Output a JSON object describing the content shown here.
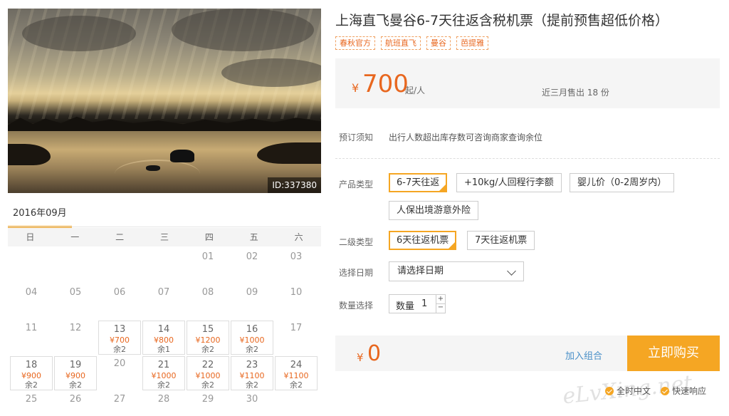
{
  "hero": {
    "id_label": "ID:337380"
  },
  "calendar": {
    "month": "2016年09月",
    "weekdays": [
      "日",
      "一",
      "二",
      "三",
      "四",
      "五",
      "六"
    ]
  },
  "product": {
    "title": "上海直飞曼谷6-7天往返含税机票（提前预售超低价格）",
    "tags": [
      "春秋官方",
      "航班直飞",
      "曼谷",
      "芭提雅"
    ],
    "price": {
      "currency": "¥",
      "value": "700",
      "unit": "起/人",
      "sold": "近三月售出 18 份"
    },
    "notice": {
      "label": "预订须知",
      "text": "出行人数超出库存数可咨询商家查询余位"
    },
    "product_type": {
      "label": "产品类型",
      "options": [
        "6-7天往返",
        "+10kg/人回程行李额",
        "婴儿价（0-2周岁内）",
        "人保出境游意外险"
      ]
    },
    "sub_type": {
      "label": "二级类型",
      "options": [
        "6天往返机票",
        "7天往返机票"
      ]
    },
    "date": {
      "label": "选择日期",
      "placeholder": "请选择日期"
    },
    "quantity": {
      "label": "数量选择",
      "field_label": "数量",
      "value": "1",
      "plus": "+",
      "minus": "−"
    },
    "total": {
      "currency": "¥",
      "value": "0"
    },
    "combo_label": "加入组合",
    "buy_label": "立即购买",
    "features": [
      "全时中文",
      "快速响应"
    ],
    "watermark": "eLvXing.net"
  },
  "days": [
    {
      "d": "01"
    },
    {
      "d": "02"
    },
    {
      "d": "03"
    },
    {
      "d": "04"
    },
    {
      "d": "05"
    },
    {
      "d": "06"
    },
    {
      "d": "07"
    },
    {
      "d": "08"
    },
    {
      "d": "09"
    },
    {
      "d": "10"
    },
    {
      "d": "11"
    },
    {
      "d": "12"
    },
    {
      "d": "13",
      "p": "¥700",
      "s": "余2"
    },
    {
      "d": "14",
      "p": "¥800",
      "s": "余1"
    },
    {
      "d": "15",
      "p": "¥1200",
      "s": "余2"
    },
    {
      "d": "16",
      "p": "¥1000",
      "s": "余2"
    },
    {
      "d": "17"
    },
    {
      "d": "18",
      "p": "¥900",
      "s": "余2"
    },
    {
      "d": "19",
      "p": "¥900",
      "s": "余2"
    },
    {
      "d": "20"
    },
    {
      "d": "21",
      "p": "¥1000",
      "s": "余2"
    },
    {
      "d": "22",
      "p": "¥1000",
      "s": "余2"
    },
    {
      "d": "23",
      "p": "¥1100",
      "s": "余2"
    },
    {
      "d": "24",
      "p": "¥1100",
      "s": "余2"
    },
    {
      "d": "25"
    },
    {
      "d": "26"
    },
    {
      "d": "27"
    },
    {
      "d": "28"
    },
    {
      "d": "29"
    },
    {
      "d": "30"
    }
  ]
}
